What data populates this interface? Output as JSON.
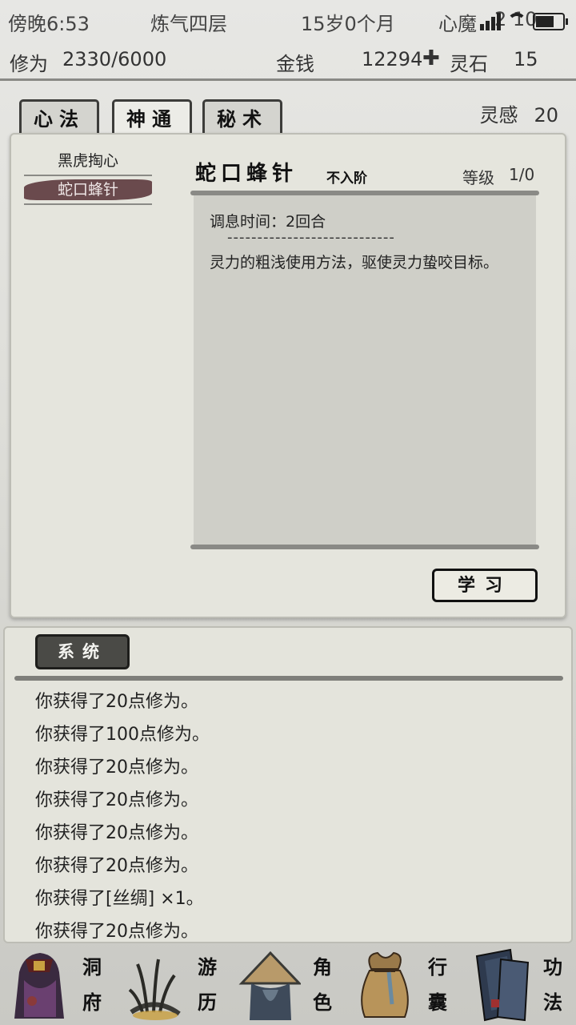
{
  "status_bar": {
    "time": "傍晚6:53",
    "realm": "炼气四层",
    "age": "15岁0个月",
    "demon_label": "心魔",
    "demon_value": "2 10"
  },
  "stats": {
    "cultivation_label": "修为",
    "cultivation_value": "2330/6000",
    "money_label": "金钱",
    "money_value": "12294",
    "money_icon": "✚",
    "spirit_stone_label": "灵石",
    "spirit_stone_value": "15"
  },
  "tabs": [
    {
      "label": "心法"
    },
    {
      "label": "神通"
    },
    {
      "label": "秘术"
    }
  ],
  "insight": {
    "label": "灵感",
    "value": "20"
  },
  "skills": [
    {
      "name": "黑虎掏心"
    },
    {
      "name": "蛇口蜂针"
    }
  ],
  "selected_skill": {
    "title": "蛇口蜂针",
    "tier": "不入阶",
    "level_label": "等级",
    "level_value": "1/0",
    "cooldown": "调息时间：2回合",
    "separator": "----------------------------",
    "description": "灵力的粗浅使用方法，驱使灵力蛰咬目标。"
  },
  "learn_button": "学习",
  "log": {
    "tab_label": "系统",
    "lines": [
      "你获得了20点修为。",
      "你获得了100点修为。",
      "你获得了20点修为。",
      "你获得了20点修为。",
      "你获得了20点修为。",
      "你获得了20点修为。",
      "你获得了[丝绸] ×1。",
      "你获得了20点修为。"
    ]
  },
  "nav": [
    {
      "label": "洞府",
      "icon": "cave-dwelling-icon"
    },
    {
      "label": "游历",
      "icon": "grass-travel-icon"
    },
    {
      "label": "角色",
      "icon": "straw-hat-character-icon"
    },
    {
      "label": "行囊",
      "icon": "bag-inventory-icon"
    },
    {
      "label": "功法",
      "icon": "scroll-books-icon"
    }
  ],
  "colors": {
    "accent_dark": "#4a4a46",
    "selected_brush": "#6a4a4d",
    "panel_bg": "#e5e5dd"
  }
}
